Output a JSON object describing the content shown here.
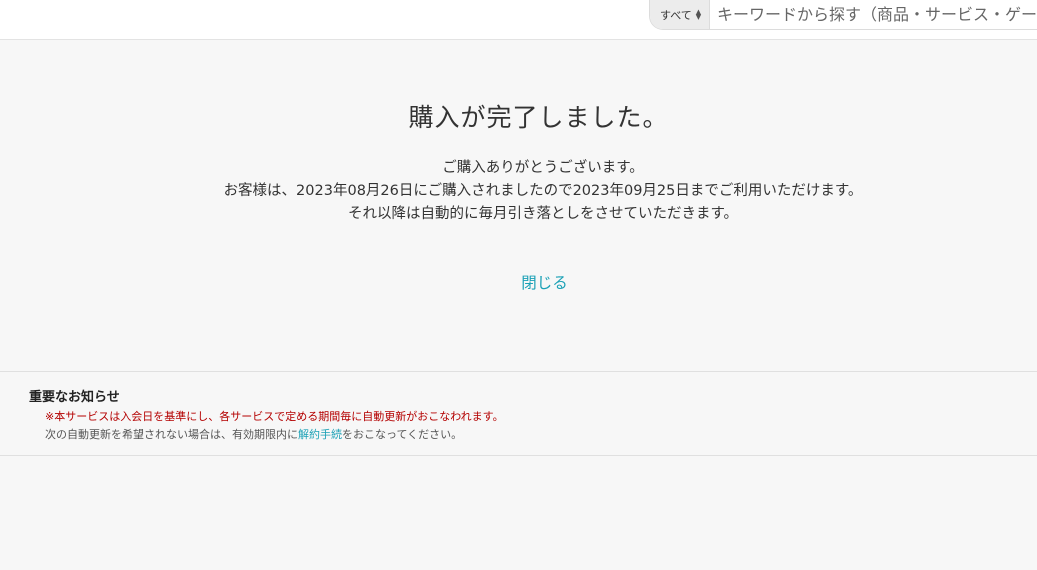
{
  "header": {
    "search": {
      "category_label": "すべて",
      "placeholder": "キーワードから探す（商品・サービス・ゲーム"
    }
  },
  "main": {
    "title": "購入が完了しました。",
    "message_lines": [
      "ご購入ありがとうございます。",
      "お客様は、2023年08月26日にご購入されましたので2023年09月25日までご利用いただけます。",
      "それ以降は自動的に毎月引き落としをさせていただきます。"
    ],
    "close_label": "閉じる"
  },
  "notice": {
    "title": "重要なお知らせ",
    "warning": "※本サービスは入会日を基準にし、各サービスで定める期間毎に自動更新がおこなわれます。",
    "text_before": "次の自動更新を希望されない場合は、有効期限内に",
    "link_label": "解約手続",
    "text_after": "をおこなってください。"
  },
  "colors": {
    "accent": "#1ba1b6",
    "warning": "#b40000",
    "background": "#f7f7f7"
  }
}
